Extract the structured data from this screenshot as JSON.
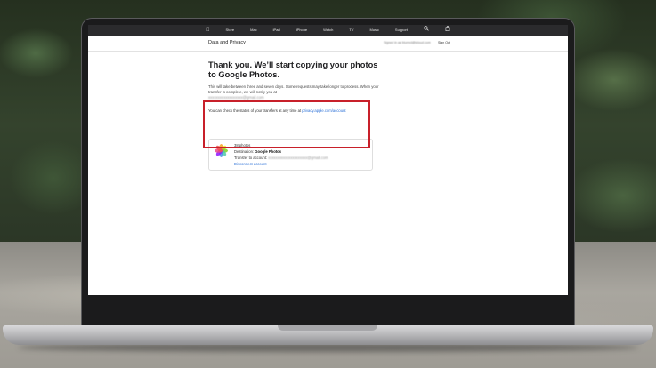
{
  "globalnav": {
    "items": [
      "Store",
      "Mac",
      "iPad",
      "iPhone",
      "Watch",
      "TV",
      "Music",
      "Support"
    ]
  },
  "subnav": {
    "title": "Data and Privacy",
    "signed_in_as": "Signed in as blurred@icloud.com",
    "sign_out": "Sign Out"
  },
  "content": {
    "heading": "Thank you. We’ll start copying your photos to Google Photos.",
    "paragraph": "This will take between three and seven days. Some requests may take longer to process. When your transfer is complete, we will notify you at",
    "email_blurred": "xxxxxxxxxxxxxxxxxx@gmail.com",
    "status_prefix": "You can check the status of your transfers at any time at",
    "status_link": "privacy.apple.com/account"
  },
  "card": {
    "photos_count": "38 photos",
    "destination_label": "Destination:",
    "destination_value": "Google Photos",
    "transfer_label": "Transfer to account:",
    "transfer_value_blurred": "xxxxxxxxxxxxxxxxxxxxx@gmail.com",
    "disconnect": "Disconnect account"
  },
  "colors": {
    "highlight": "#c8202a",
    "link": "#2a6fd6",
    "nav_bg": "#2b2b2d"
  }
}
